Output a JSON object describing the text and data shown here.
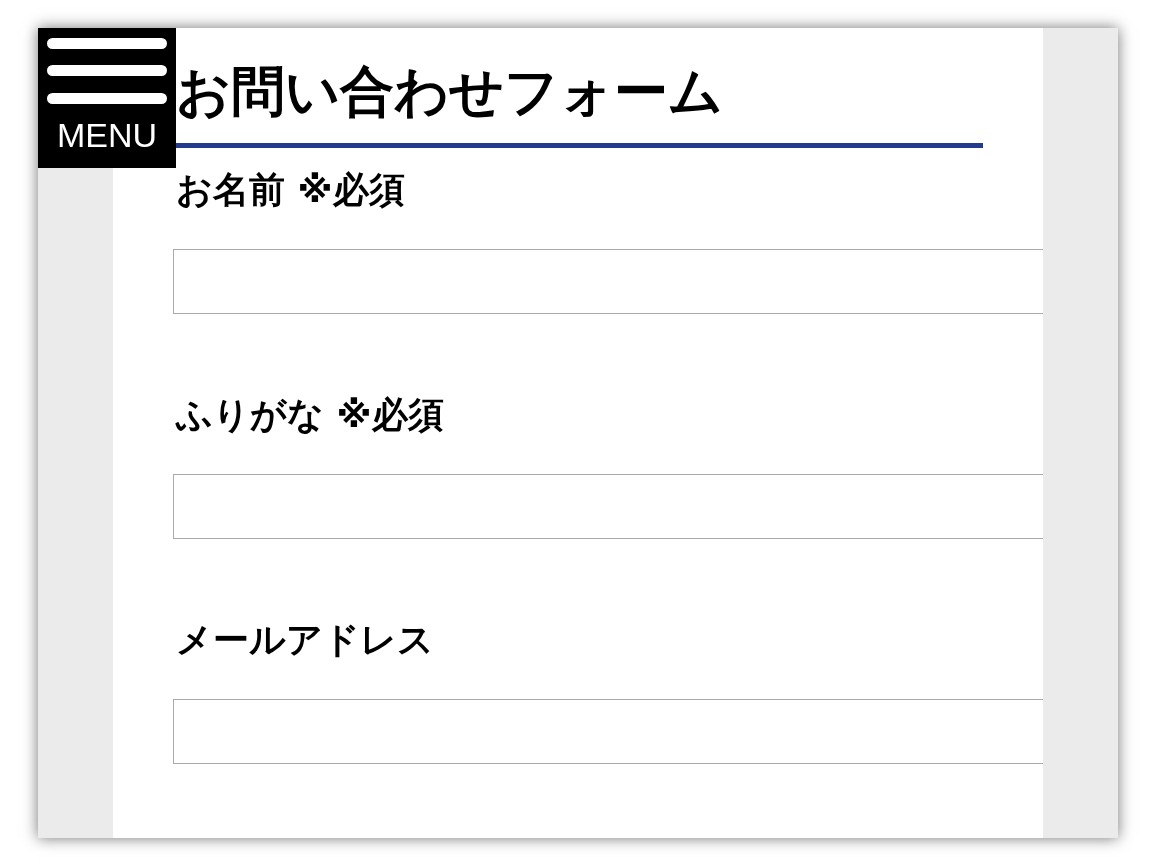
{
  "menu_button": {
    "label": "MENU"
  },
  "title": "お問い合わせフォーム",
  "fields": [
    {
      "label": "お名前 ※必須"
    },
    {
      "label": "ふりがな ※必須"
    },
    {
      "label": "メールアドレス"
    }
  ]
}
